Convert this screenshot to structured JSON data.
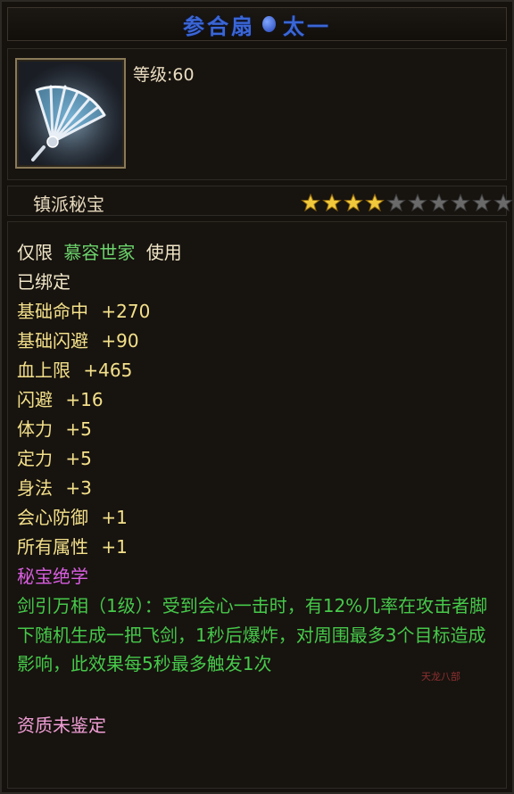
{
  "item": {
    "name_part1": "参合扇",
    "name_part2": "太一",
    "level_text": "等级:60",
    "type_label": "镇派秘宝",
    "stars_filled": 4,
    "stars_total": 10,
    "star_colors": {
      "filled": "#f2c93a",
      "empty": "#6a6a6a"
    },
    "icon": "bone-fan-icon"
  },
  "restriction": {
    "prefix": "仅限",
    "faction": "慕容世家",
    "suffix": "使用"
  },
  "bound_text": "已绑定",
  "attributes": [
    {
      "label": "基础命中",
      "value": "+270"
    },
    {
      "label": "基础闪避",
      "value": "+90"
    },
    {
      "label": "血上限",
      "value": "+465"
    },
    {
      "label": "闪避",
      "value": "+16"
    },
    {
      "label": "体力",
      "value": "+5"
    },
    {
      "label": "定力",
      "value": "+5"
    },
    {
      "label": "身法",
      "value": "+3"
    },
    {
      "label": "会心防御",
      "value": "+1"
    },
    {
      "label": "所有属性",
      "value": "+1"
    }
  ],
  "skill": {
    "heading": "秘宝绝学",
    "description": "剑引万相（1级）：受到会心一击时，有12%几率在攻击者脚下随机生成一把飞剑，1秒后爆炸，对周围最多3个目标造成影响，此效果每5秒最多触发1次"
  },
  "quality_text": "资质未鉴定",
  "watermark": "天龙八部"
}
